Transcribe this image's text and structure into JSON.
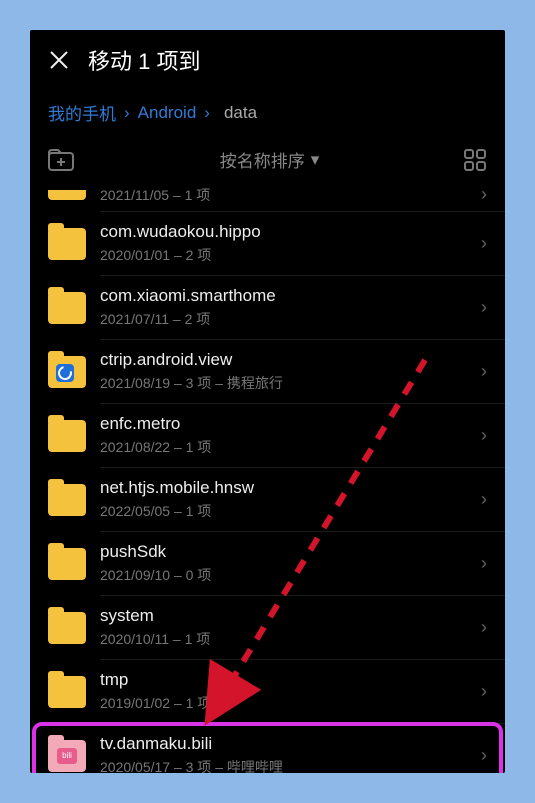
{
  "header": {
    "title": "移动 1 项到"
  },
  "breadcrumb": {
    "items": [
      "我的手机",
      "Android"
    ],
    "current": "data"
  },
  "sort_label": "按名称排序",
  "rows": [
    {
      "name": "",
      "meta": "2021/11/05 – 1 项",
      "cut": true,
      "icon": "folder"
    },
    {
      "name": "com.wudaokou.hippo",
      "meta": "2020/01/01 – 2 项",
      "icon": "folder"
    },
    {
      "name": "com.xiaomi.smarthome",
      "meta": "2021/07/11 – 2 项",
      "icon": "folder"
    },
    {
      "name": "ctrip.android.view",
      "meta": "2021/08/19 – 3 项 – 携程旅行",
      "icon": "app"
    },
    {
      "name": "enfc.metro",
      "meta": "2021/08/22 – 1 项",
      "icon": "folder"
    },
    {
      "name": "net.htjs.mobile.hnsw",
      "meta": "2022/05/05 – 1 项",
      "icon": "folder"
    },
    {
      "name": "pushSdk",
      "meta": "2021/09/10 – 0 项",
      "icon": "folder"
    },
    {
      "name": "system",
      "meta": "2020/10/11 – 1 项",
      "icon": "folder"
    },
    {
      "name": "tmp",
      "meta": "2019/01/02 – 1 项",
      "icon": "folder"
    },
    {
      "name": "tv.danmaku.bili",
      "meta": "2020/05/17 – 3 项 – 哔哩哔哩",
      "icon": "bili",
      "highlight": true
    }
  ]
}
